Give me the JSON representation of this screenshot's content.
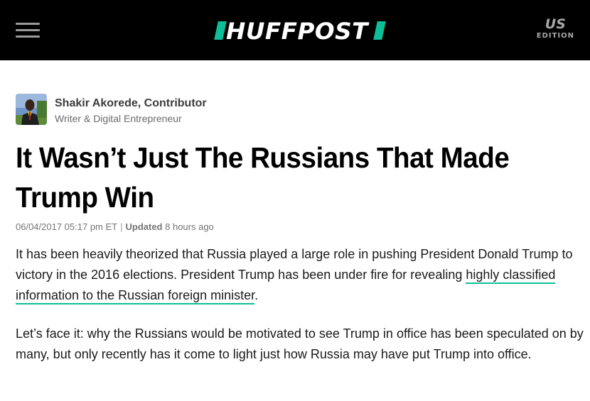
{
  "header": {
    "menu_icon": "hamburger-menu-icon",
    "logo_text": "HUFFPOST",
    "edition_code": "US",
    "edition_label": "EDITION",
    "background_color": "#000000",
    "accent_color": "#0dbe98"
  },
  "author": {
    "name": "Shakir Akorede, Contributor",
    "role": "Writer & Digital Entrepreneur"
  },
  "article": {
    "headline": "It Wasn’t Just The Russians That Made Trump Win",
    "published": "06/04/2017 05:17 pm ET",
    "separator": "|",
    "updated_label": "Updated",
    "updated_ago": "8 hours ago",
    "paragraph1_before": "It has been heavily theorized that Russia played a large role in pushing President Donald Trump to victory in the 2016 elections. President Trump has been under fire for revealing ",
    "paragraph1_link": "highly classified information to the Russian foreign minister",
    "paragraph1_after": ".",
    "paragraph2": "Let’s face it: why the Russians would be motivated to see Trump in office has been speculated on by many, but only recently has it come to light just how Russia may have put Trump into office."
  }
}
